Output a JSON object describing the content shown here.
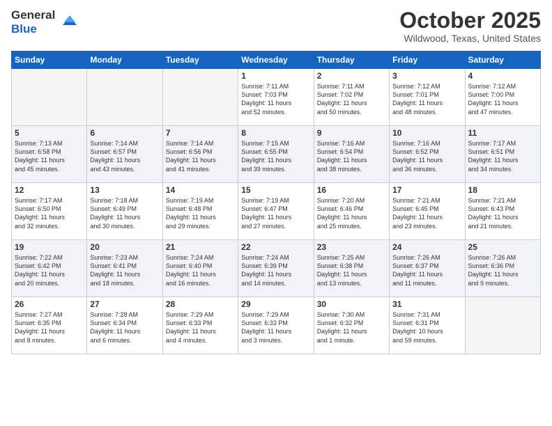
{
  "header": {
    "logo": {
      "line1": "General",
      "line2": "Blue"
    },
    "title": "October 2025",
    "location": "Wildwood, Texas, United States"
  },
  "weekdays": [
    "Sunday",
    "Monday",
    "Tuesday",
    "Wednesday",
    "Thursday",
    "Friday",
    "Saturday"
  ],
  "weeks": [
    [
      {
        "day": "",
        "info": ""
      },
      {
        "day": "",
        "info": ""
      },
      {
        "day": "",
        "info": ""
      },
      {
        "day": "1",
        "info": "Sunrise: 7:11 AM\nSunset: 7:03 PM\nDaylight: 11 hours\nand 52 minutes."
      },
      {
        "day": "2",
        "info": "Sunrise: 7:11 AM\nSunset: 7:02 PM\nDaylight: 11 hours\nand 50 minutes."
      },
      {
        "day": "3",
        "info": "Sunrise: 7:12 AM\nSunset: 7:01 PM\nDaylight: 11 hours\nand 48 minutes."
      },
      {
        "day": "4",
        "info": "Sunrise: 7:12 AM\nSunset: 7:00 PM\nDaylight: 11 hours\nand 47 minutes."
      }
    ],
    [
      {
        "day": "5",
        "info": "Sunrise: 7:13 AM\nSunset: 6:58 PM\nDaylight: 11 hours\nand 45 minutes."
      },
      {
        "day": "6",
        "info": "Sunrise: 7:14 AM\nSunset: 6:57 PM\nDaylight: 11 hours\nand 43 minutes."
      },
      {
        "day": "7",
        "info": "Sunrise: 7:14 AM\nSunset: 6:56 PM\nDaylight: 11 hours\nand 41 minutes."
      },
      {
        "day": "8",
        "info": "Sunrise: 7:15 AM\nSunset: 6:55 PM\nDaylight: 11 hours\nand 39 minutes."
      },
      {
        "day": "9",
        "info": "Sunrise: 7:16 AM\nSunset: 6:54 PM\nDaylight: 11 hours\nand 38 minutes."
      },
      {
        "day": "10",
        "info": "Sunrise: 7:16 AM\nSunset: 6:52 PM\nDaylight: 11 hours\nand 36 minutes."
      },
      {
        "day": "11",
        "info": "Sunrise: 7:17 AM\nSunset: 6:51 PM\nDaylight: 11 hours\nand 34 minutes."
      }
    ],
    [
      {
        "day": "12",
        "info": "Sunrise: 7:17 AM\nSunset: 6:50 PM\nDaylight: 11 hours\nand 32 minutes."
      },
      {
        "day": "13",
        "info": "Sunrise: 7:18 AM\nSunset: 6:49 PM\nDaylight: 11 hours\nand 30 minutes."
      },
      {
        "day": "14",
        "info": "Sunrise: 7:19 AM\nSunset: 6:48 PM\nDaylight: 11 hours\nand 29 minutes."
      },
      {
        "day": "15",
        "info": "Sunrise: 7:19 AM\nSunset: 6:47 PM\nDaylight: 11 hours\nand 27 minutes."
      },
      {
        "day": "16",
        "info": "Sunrise: 7:20 AM\nSunset: 6:46 PM\nDaylight: 11 hours\nand 25 minutes."
      },
      {
        "day": "17",
        "info": "Sunrise: 7:21 AM\nSunset: 6:45 PM\nDaylight: 11 hours\nand 23 minutes."
      },
      {
        "day": "18",
        "info": "Sunrise: 7:21 AM\nSunset: 6:43 PM\nDaylight: 11 hours\nand 21 minutes."
      }
    ],
    [
      {
        "day": "19",
        "info": "Sunrise: 7:22 AM\nSunset: 6:42 PM\nDaylight: 11 hours\nand 20 minutes."
      },
      {
        "day": "20",
        "info": "Sunrise: 7:23 AM\nSunset: 6:41 PM\nDaylight: 11 hours\nand 18 minutes."
      },
      {
        "day": "21",
        "info": "Sunrise: 7:24 AM\nSunset: 6:40 PM\nDaylight: 11 hours\nand 16 minutes."
      },
      {
        "day": "22",
        "info": "Sunrise: 7:24 AM\nSunset: 6:39 PM\nDaylight: 11 hours\nand 14 minutes."
      },
      {
        "day": "23",
        "info": "Sunrise: 7:25 AM\nSunset: 6:38 PM\nDaylight: 11 hours\nand 13 minutes."
      },
      {
        "day": "24",
        "info": "Sunrise: 7:26 AM\nSunset: 6:37 PM\nDaylight: 11 hours\nand 11 minutes."
      },
      {
        "day": "25",
        "info": "Sunrise: 7:26 AM\nSunset: 6:36 PM\nDaylight: 11 hours\nand 9 minutes."
      }
    ],
    [
      {
        "day": "26",
        "info": "Sunrise: 7:27 AM\nSunset: 6:35 PM\nDaylight: 11 hours\nand 8 minutes."
      },
      {
        "day": "27",
        "info": "Sunrise: 7:28 AM\nSunset: 6:34 PM\nDaylight: 11 hours\nand 6 minutes."
      },
      {
        "day": "28",
        "info": "Sunrise: 7:29 AM\nSunset: 6:33 PM\nDaylight: 11 hours\nand 4 minutes."
      },
      {
        "day": "29",
        "info": "Sunrise: 7:29 AM\nSunset: 6:33 PM\nDaylight: 11 hours\nand 3 minutes."
      },
      {
        "day": "30",
        "info": "Sunrise: 7:30 AM\nSunset: 6:32 PM\nDaylight: 11 hours\nand 1 minute."
      },
      {
        "day": "31",
        "info": "Sunrise: 7:31 AM\nSunset: 6:31 PM\nDaylight: 10 hours\nand 59 minutes."
      },
      {
        "day": "",
        "info": ""
      }
    ]
  ]
}
